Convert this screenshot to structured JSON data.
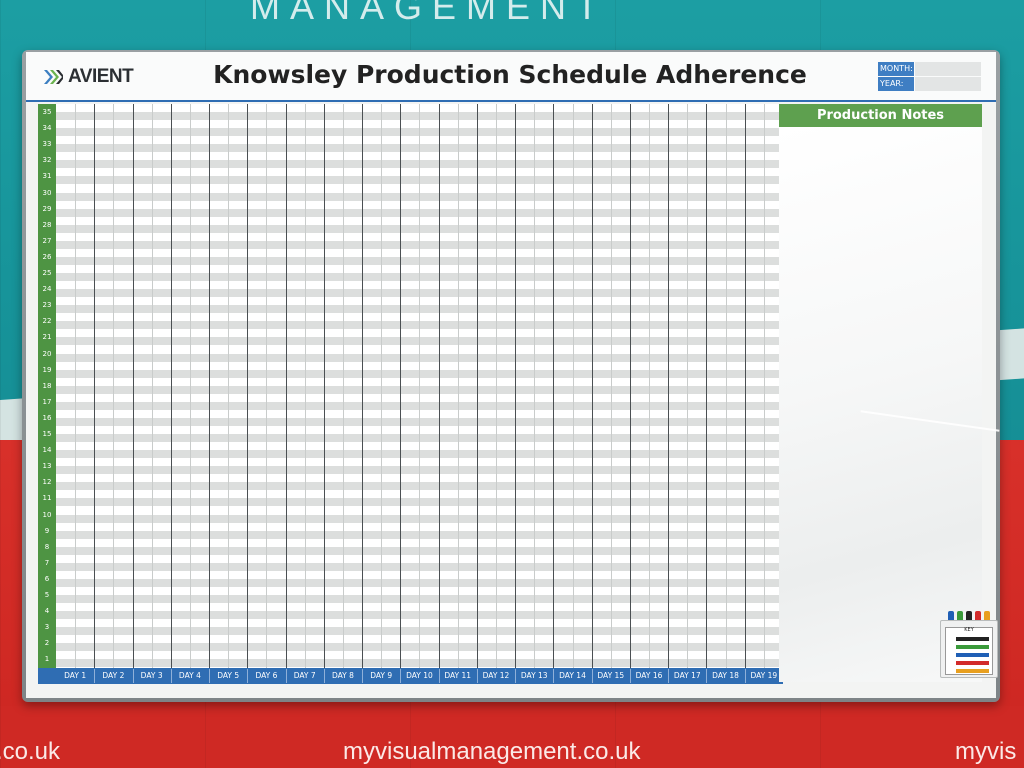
{
  "wall": {
    "footer_url": "myvisualmanagement.co.uk",
    "footer_left": ".co.uk",
    "footer_right": "myvis",
    "top_text": "MANAGEMENT"
  },
  "board": {
    "logo": "AVIENT",
    "title": "Knowsley Production Schedule Adherence",
    "month_label": "MONTH:",
    "year_label": "YEAR:",
    "notes_title": "Production Notes",
    "rows": [
      "35",
      "34",
      "33",
      "32",
      "31",
      "30",
      "29",
      "28",
      "27",
      "26",
      "25",
      "24",
      "23",
      "22",
      "21",
      "20",
      "19",
      "18",
      "17",
      "16",
      "15",
      "14",
      "13",
      "12",
      "11",
      "10",
      "9",
      "8",
      "7",
      "6",
      "5",
      "4",
      "3",
      "2",
      "1"
    ],
    "days": [
      "DAY 1",
      "DAY 2",
      "DAY 3",
      "DAY 4",
      "DAY 5",
      "DAY 6",
      "DAY 7",
      "DAY 8",
      "DAY 9",
      "DAY 10",
      "DAY 11",
      "DAY 12",
      "DAY 13",
      "DAY 14",
      "DAY 15",
      "DAY 16",
      "DAY 17",
      "DAY 18",
      "DAY 19"
    ],
    "key_title": "KEY"
  },
  "colors": {
    "axis_green": "#4e9443",
    "day_blue": "#2f6db3",
    "notes_green": "#5ea04f",
    "marker_colors": [
      "#1f5fb5",
      "#3a9a3a",
      "#222222",
      "#d22b2b",
      "#e8a020"
    ],
    "key_colors": [
      "#222222",
      "#3a9a3a",
      "#1f5fb5",
      "#d22b2b",
      "#e8a020"
    ]
  }
}
